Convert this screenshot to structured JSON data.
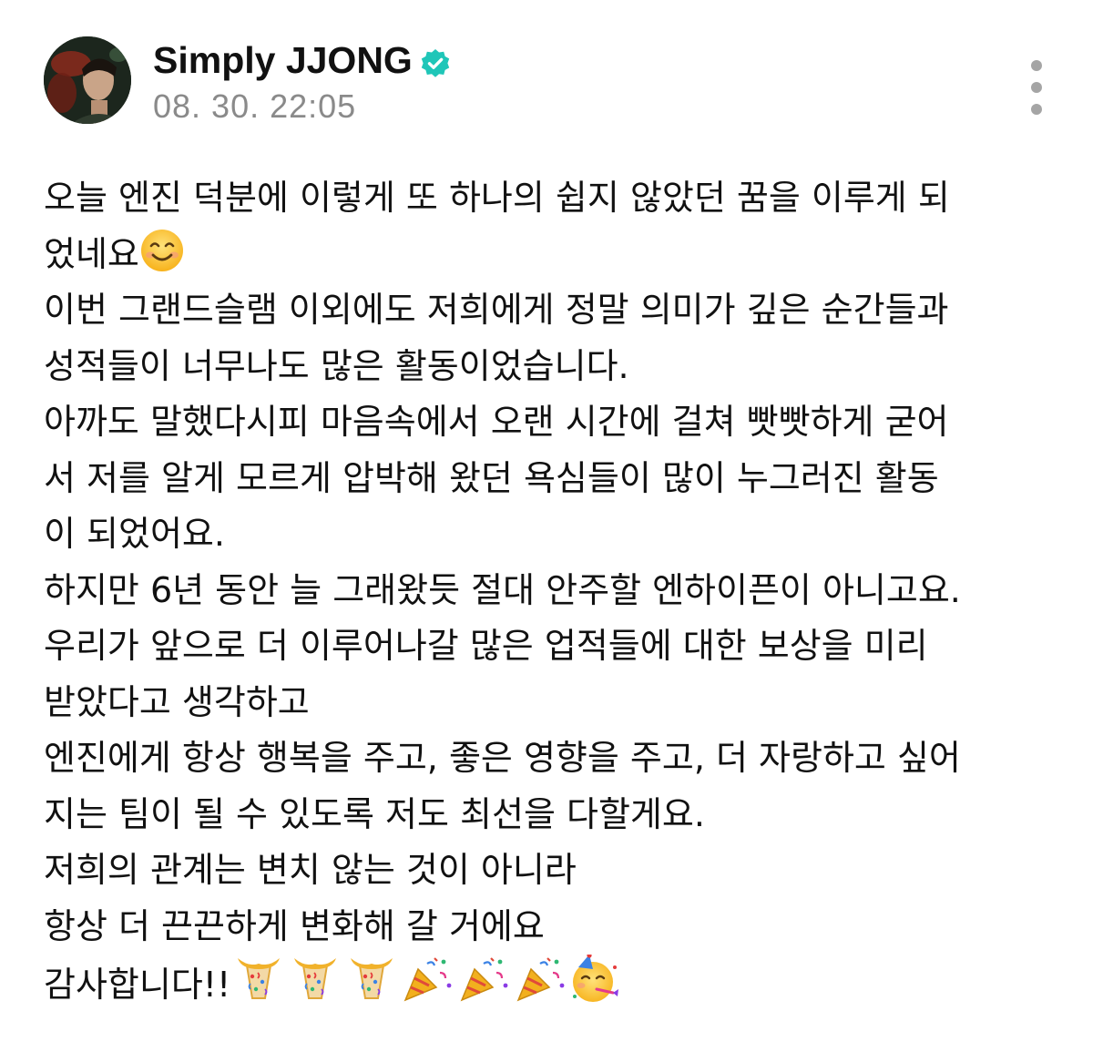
{
  "post": {
    "author": "Simply JJONG",
    "verified": true,
    "timestamp": "08. 30. 22:05",
    "more_menu_icon": "more-vertical-icon",
    "lines": [
      "오늘 엔진 덕분에 이렇게 또 하나의 쉽지 않았던 꿈을 이루게 되",
      "었네요",
      "이번 그랜드슬램 이외에도 저희에게 정말 의미가 깊은 순간들과",
      "성적들이 너무나도 많은 활동이었습니다.",
      "아까도 말했다시피 마음속에서 오랜 시간에 걸쳐 빳빳하게 굳어",
      "서 저를 알게 모르게 압박해 왔던 욕심들이 많이 누그러진 활동",
      "이 되었어요.",
      "하지만 6년 동안 늘 그래왔듯 절대 안주할 엔하이픈이 아니고요.",
      "우리가 앞으로 더 이루어나갈 많은 업적들에 대한 보상을 미리",
      "받았다고 생각하고",
      "엔진에게 항상 행복을 주고, 좋은 영향을 주고, 더 자랑하고 싶어",
      "지는 팀이 될 수 있도록 저도 최선을 다할게요.",
      "저희의 관계는 변치 않는 것이 아니라",
      "항상 더 끈끈하게 변화해 갈 거에요",
      "감사합니다!!"
    ],
    "emojis": {
      "smile": "smiling-face-emoji",
      "ending": [
        "confetti-ball-emoji",
        "confetti-ball-emoji",
        "confetti-ball-emoji",
        "party-popper-emoji",
        "party-popper-emoji",
        "party-popper-emoji",
        "partying-face-emoji"
      ]
    }
  },
  "colors": {
    "text": "#111111",
    "timestamp": "#8a8a8a",
    "verified_badge": "#1fc6b8",
    "more_dots": "#a5a5a5"
  }
}
